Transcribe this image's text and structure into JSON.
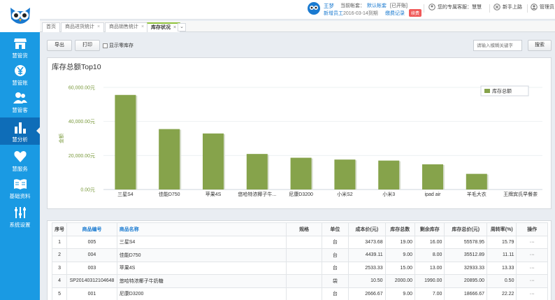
{
  "sidebar": {
    "items": [
      {
        "label": "慧管货",
        "icon": "store-icon"
      },
      {
        "label": "慧管账",
        "icon": "yen-icon"
      },
      {
        "label": "慧管客",
        "icon": "users-icon"
      },
      {
        "label": "慧分析",
        "icon": "bar-chart-icon",
        "active": true
      },
      {
        "label": "慧服务",
        "icon": "heart-icon"
      },
      {
        "label": "基础资料",
        "icon": "book-icon"
      },
      {
        "label": "系统设置",
        "icon": "sliders-icon"
      }
    ]
  },
  "header": {
    "user_name": "王梦",
    "account_label": "当前帐套：",
    "account_value": "默认帐套",
    "account_status": "[已开账]",
    "role": "新增员工",
    "expire": "2016-03-14到期",
    "pay_link": "缴费记录",
    "badge": "续费",
    "service": "您的专属客服：慧慧",
    "newbie": "新手上路",
    "admin": "管理员"
  },
  "tabs": [
    {
      "label": "首页"
    },
    {
      "label": "商品进货统计"
    },
    {
      "label": "商品销售统计"
    },
    {
      "label": "库存状况",
      "active": true
    }
  ],
  "toolbar": {
    "export": "导出",
    "print": "打印",
    "show_zero": "显示零库存",
    "search_placeholder": "请输入模糊关键字",
    "search": "搜索"
  },
  "chart_data": {
    "type": "bar",
    "title": "库存总额Top10",
    "ylabel": "金额",
    "legend": "库存总额",
    "legend_position": "top-right",
    "yticks": [
      "0.00元",
      "20,000.00元",
      "40,000.00元",
      "60,000.00元"
    ],
    "ylim": [
      0,
      60000
    ],
    "grid": true,
    "categories": [
      "三星S4",
      "佳能D750",
      "苹果4S",
      "悠哈特浓椰子牛...",
      "尼康D3200",
      "小米S2",
      "小米3",
      "ipad air",
      "羊毛大衣",
      "王牌宾氏早餐茶"
    ],
    "values": [
      55579,
      35513,
      32933,
      20895,
      18667,
      17600,
      17000,
      14800,
      9200,
      0
    ],
    "color": "#86a34b"
  },
  "table": {
    "headers": [
      "序号",
      "商品编号",
      "商品名称",
      "规格",
      "单位",
      "成本价(元)",
      "库存总数",
      "剩余库存",
      "库存总价(元)",
      "周转率(%)",
      "操作"
    ],
    "rows": [
      [
        "1",
        "005",
        "三星S4",
        "",
        "台",
        "3473.68",
        "19.00",
        "16.00",
        "55578.95",
        "15.79",
        "···"
      ],
      [
        "2",
        "004",
        "佳能D750",
        "",
        "台",
        "4439.11",
        "9.00",
        "8.00",
        "35512.89",
        "11.11",
        "···"
      ],
      [
        "3",
        "003",
        "苹果4S",
        "",
        "台",
        "2533.33",
        "15.00",
        "13.00",
        "32933.33",
        "13.33",
        "···"
      ],
      [
        "4",
        "SP20140312104648",
        "悠哈特浓椰子牛奶糖",
        "",
        "袋",
        "10.50",
        "2000.00",
        "1990.00",
        "20895.00",
        "0.50",
        "···"
      ],
      [
        "5",
        "001",
        "尼康D3200",
        "",
        "台",
        "2666.67",
        "9.00",
        "7.00",
        "18666.67",
        "22.22",
        "···"
      ]
    ]
  }
}
